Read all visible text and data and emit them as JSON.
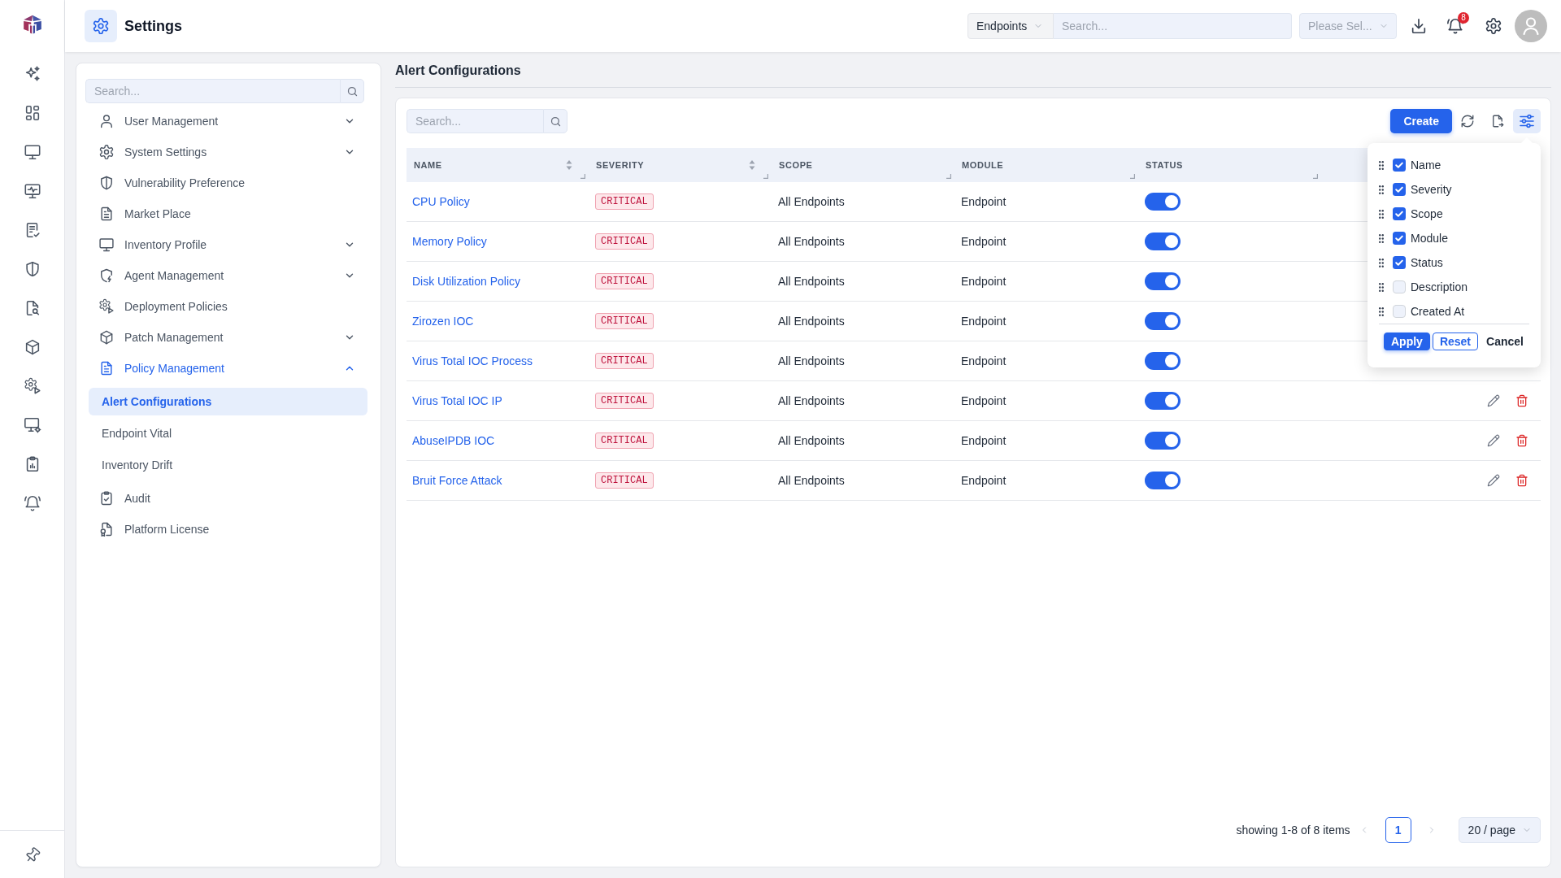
{
  "header": {
    "title": "Settings",
    "scope_select": {
      "value": "Endpoints"
    },
    "search": {
      "placeholder": "Search..."
    },
    "filter_select": {
      "placeholder": "Please Sel..."
    },
    "notifications": {
      "count": "8"
    }
  },
  "sidebar": {
    "search": {
      "placeholder": "Search..."
    },
    "items": [
      {
        "label": "User Management",
        "kind": "group",
        "expanded": false,
        "selected": false
      },
      {
        "label": "System Settings",
        "kind": "group",
        "expanded": false,
        "selected": false
      },
      {
        "label": "Vulnerability Preference",
        "kind": "link",
        "selected": false
      },
      {
        "label": "Market Place",
        "kind": "link",
        "selected": false
      },
      {
        "label": "Inventory Profile",
        "kind": "group",
        "expanded": false,
        "selected": false
      },
      {
        "label": "Agent Management",
        "kind": "group",
        "expanded": false,
        "selected": false
      },
      {
        "label": "Deployment Policies",
        "kind": "link",
        "selected": false
      },
      {
        "label": "Patch Management",
        "kind": "group",
        "expanded": false,
        "selected": false
      },
      {
        "label": "Policy Management",
        "kind": "group",
        "expanded": true,
        "selected": true,
        "children": [
          {
            "label": "Alert Configurations",
            "selected": true
          },
          {
            "label": "Endpoint Vital",
            "selected": false
          },
          {
            "label": "Inventory Drift",
            "selected": false
          }
        ]
      },
      {
        "label": "Audit",
        "kind": "link",
        "selected": false
      },
      {
        "label": "Platform License",
        "kind": "link",
        "selected": false
      }
    ]
  },
  "page_title": "Alert Configurations",
  "toolbar": {
    "search": {
      "placeholder": "Search..."
    },
    "create_button": "Create"
  },
  "column_menu": {
    "open": true,
    "items": [
      {
        "label": "Name",
        "checked": true
      },
      {
        "label": "Severity",
        "checked": true
      },
      {
        "label": "Scope",
        "checked": true
      },
      {
        "label": "Module",
        "checked": true
      },
      {
        "label": "Status",
        "checked": true
      },
      {
        "label": "Description",
        "checked": false
      },
      {
        "label": "Created At",
        "checked": false
      }
    ],
    "buttons": [
      {
        "label": "Apply",
        "kind": "primary"
      },
      {
        "label": "Reset",
        "kind": "outline"
      },
      {
        "label": "Cancel",
        "kind": "text"
      }
    ]
  },
  "table": {
    "columns": [
      {
        "label": "NAME",
        "sortable": true
      },
      {
        "label": "SEVERITY",
        "sortable": true
      },
      {
        "label": "SCOPE",
        "sortable": false
      },
      {
        "label": "MODULE",
        "sortable": false
      },
      {
        "label": "STATUS",
        "sortable": false
      }
    ],
    "rows": [
      {
        "name": "CPU Policy",
        "severity": "CRITICAL",
        "scope": "All Endpoints",
        "module": "Endpoint",
        "enabled": true
      },
      {
        "name": "Memory Policy",
        "severity": "CRITICAL",
        "scope": "All Endpoints",
        "module": "Endpoint",
        "enabled": true
      },
      {
        "name": "Disk Utilization Policy",
        "severity": "CRITICAL",
        "scope": "All Endpoints",
        "module": "Endpoint",
        "enabled": true
      },
      {
        "name": "Zirozen IOC",
        "severity": "CRITICAL",
        "scope": "All Endpoints",
        "module": "Endpoint",
        "enabled": true
      },
      {
        "name": "Virus Total IOC Process",
        "severity": "CRITICAL",
        "scope": "All Endpoints",
        "module": "Endpoint",
        "enabled": true
      },
      {
        "name": "Virus Total IOC IP",
        "severity": "CRITICAL",
        "scope": "All Endpoints",
        "module": "Endpoint",
        "enabled": true
      },
      {
        "name": "AbuseIPDB IOC",
        "severity": "CRITICAL",
        "scope": "All Endpoints",
        "module": "Endpoint",
        "enabled": true
      },
      {
        "name": "Bruit Force Attack",
        "severity": "CRITICAL",
        "scope": "All Endpoints",
        "module": "Endpoint",
        "enabled": true
      }
    ]
  },
  "pagination": {
    "summary": "showing 1-8 of 8 items",
    "previous": {
      "disabled": true
    },
    "pages": [
      {
        "label": "1",
        "selected": true
      }
    ],
    "next": {
      "disabled": true
    },
    "page_size": "20 / page"
  }
}
